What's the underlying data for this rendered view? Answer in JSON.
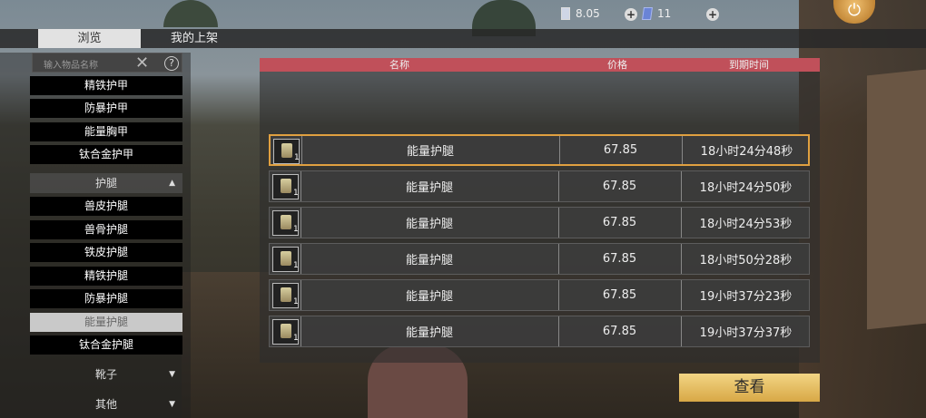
{
  "currency": {
    "primary_value": "8.05",
    "secondary_value": "11"
  },
  "tabs": [
    {
      "label": "浏览",
      "active": true
    },
    {
      "label": "我的上架",
      "active": false
    }
  ],
  "search": {
    "placeholder": "输入物品名称"
  },
  "sidebar": {
    "armor_items": [
      "精铁护甲",
      "防暴护甲",
      "能量胸甲",
      "钛合金护甲"
    ],
    "leg_category": "护腿",
    "leg_items": [
      "兽皮护腿",
      "兽骨护腿",
      "铁皮护腿",
      "精铁护腿",
      "防暴护腿",
      "能量护腿",
      "钛合金护腿"
    ],
    "selected_item": "能量护腿",
    "other_categories": [
      "靴子",
      "其他"
    ]
  },
  "table": {
    "headers": [
      "名称",
      "价格",
      "到期时间"
    ],
    "rows": [
      {
        "name": "能量护腿",
        "qty": "1",
        "price": "67.85",
        "expiry": "18小时24分48秒",
        "highlighted": true
      },
      {
        "name": "能量护腿",
        "qty": "1",
        "price": "67.85",
        "expiry": "18小时24分50秒",
        "highlighted": false
      },
      {
        "name": "能量护腿",
        "qty": "1",
        "price": "67.85",
        "expiry": "18小时24分53秒",
        "highlighted": false
      },
      {
        "name": "能量护腿",
        "qty": "1",
        "price": "67.85",
        "expiry": "18小时50分28秒",
        "highlighted": false
      },
      {
        "name": "能量护腿",
        "qty": "1",
        "price": "67.85",
        "expiry": "19小时37分23秒",
        "highlighted": false
      },
      {
        "name": "能量护腿",
        "qty": "1",
        "price": "67.85",
        "expiry": "19小时37分37秒",
        "highlighted": false
      }
    ]
  },
  "view_button": "查看",
  "colors": {
    "header_bg": "#c0505a",
    "highlight_border": "#e0a040",
    "button_gold": "#e6c060"
  }
}
